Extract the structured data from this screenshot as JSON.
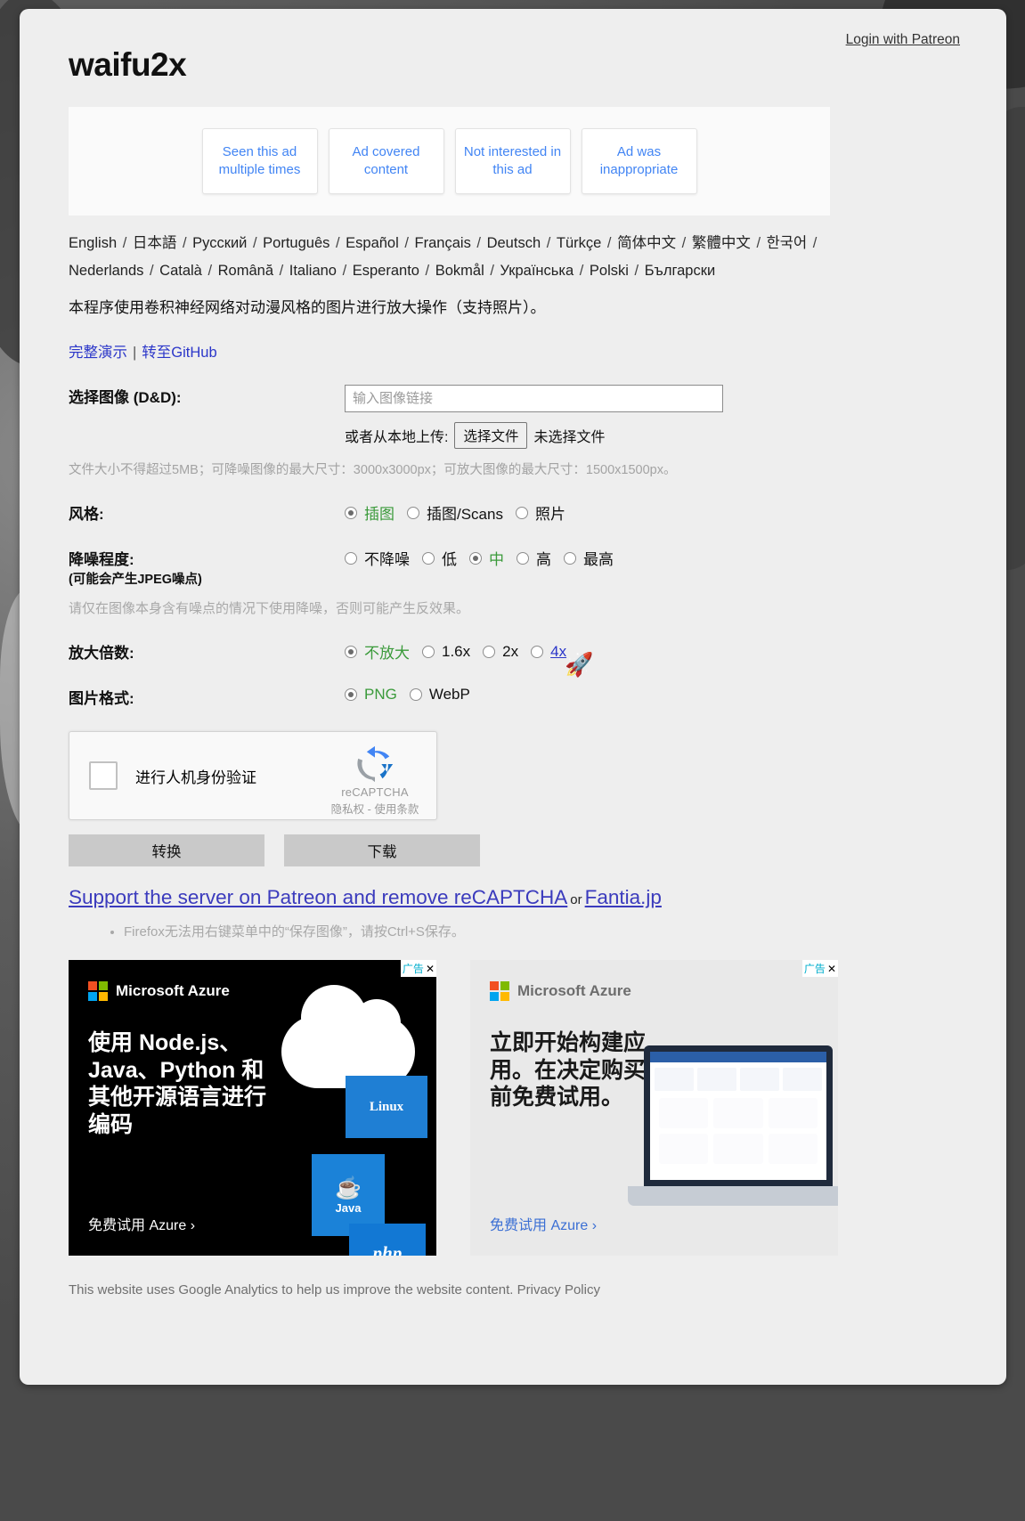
{
  "header": {
    "login_link": "Login with Patreon",
    "site_title": "waifu2x"
  },
  "ad_feedback": {
    "buttons": [
      "Seen this ad multiple times",
      "Ad covered content",
      "Not interested in this ad",
      "Ad was inappropriate"
    ]
  },
  "languages": [
    "English",
    "日本語",
    "Русский",
    "Português",
    "Español",
    "Français",
    "Deutsch",
    "Türkçe",
    "简体中文",
    "繁體中文",
    "한국어",
    "Nederlands",
    "Català",
    "Română",
    "Italiano",
    "Esperanto",
    "Bokmål",
    "Українська",
    "Polski",
    "Български"
  ],
  "description": "本程序使用卷积神经网络对动漫风格的图片进行放大操作（支持照片）。",
  "demo_links": {
    "full_demo": "完整演示",
    "separator": "|",
    "github": "转至GitHub"
  },
  "form": {
    "image_label": "选择图像 (D&D):",
    "url_placeholder": "输入图像链接",
    "url_value": "",
    "upload_prefix": "或者从本地上传:",
    "file_button": "选择文件",
    "file_status": "未选择文件",
    "size_notice": "文件大小不得超过5MB；可降噪图像的最大尺寸：3000x3000px；可放大图像的最大尺寸：1500x1500px。",
    "style": {
      "label": "风格:",
      "options": [
        "插图",
        "插图/Scans",
        "照片"
      ],
      "selected": "插图"
    },
    "noise": {
      "label": "降噪程度:",
      "sublabel": "(可能会产生JPEG噪点)",
      "options": [
        "不降噪",
        "低",
        "中",
        "高",
        "最高"
      ],
      "selected": "中",
      "note": "请仅在图像本身含有噪点的情况下使用降噪，否则可能产生反效果。"
    },
    "scale": {
      "label": "放大倍数:",
      "options": [
        "不放大",
        "1.6x",
        "2x",
        "4x"
      ],
      "selected": "不放大",
      "hovered": "4x"
    },
    "format": {
      "label": "图片格式:",
      "options": [
        "PNG",
        "WebP"
      ],
      "selected": "PNG"
    }
  },
  "recaptcha": {
    "checkbox_label": "进行人机身份验证",
    "brand": "reCAPTCHA",
    "privacy": "隐私权",
    "terms": "使用条款",
    "terms_separator": "-"
  },
  "buttons": {
    "convert": "转换",
    "download": "下载"
  },
  "support": {
    "patreon_text": "Support the server on Patreon and remove reCAPTCHA",
    "or": "or",
    "fantia_text": "Fantia.jp"
  },
  "notes": [
    "Firefox无法用右键菜单中的“保存图像”，请按Ctrl+S保存。"
  ],
  "ads": [
    {
      "badge": "广告",
      "close": "✕",
      "brand": "Microsoft Azure",
      "headline": "使用 Node.js、Java、Python 和其他开源语言进行编码",
      "cta": "免费试用 Azure ›",
      "tiles": [
        "Linux",
        "Java",
        "php"
      ],
      "theme": "dark"
    },
    {
      "badge": "广告",
      "close": "✕",
      "brand": "Microsoft Azure",
      "headline": "立即开始构建应用。在决定购买之前免费试用。",
      "cta": "免费试用 Azure ›",
      "theme": "light"
    }
  ],
  "footer": {
    "text": "This website uses Google Analytics to help us improve the website content.",
    "privacy_link": "Privacy Policy"
  },
  "cursor": {
    "icon": "🚀"
  },
  "colors": {
    "accent_link": "#2b36c9",
    "selected_label": "#3a9a3a",
    "page_bg": "#eeeeee",
    "ad_link": "#4285f4"
  }
}
